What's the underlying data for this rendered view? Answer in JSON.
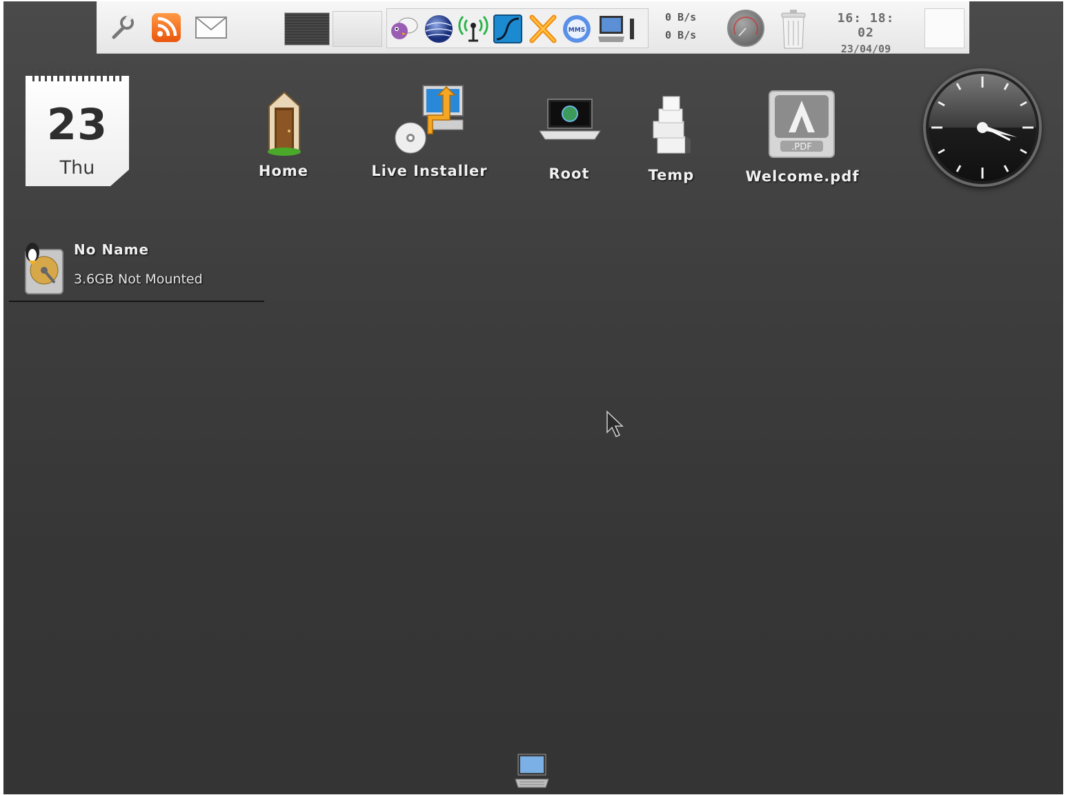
{
  "panel": {
    "launchers": [
      {
        "name": "settings",
        "icon": "wrench-icon"
      },
      {
        "name": "rss-reader",
        "icon": "rss-icon",
        "color": "#f07a1e"
      },
      {
        "name": "mail",
        "icon": "envelope-icon"
      }
    ],
    "tray_icons": [
      "chat-icon",
      "globe-icon",
      "wireless-icon",
      "monitor-graph-icon",
      "x-tools-icon",
      "mms-icon",
      "computer-icon"
    ],
    "net_speed": {
      "down": "0 B/s",
      "up": "0 B/s"
    },
    "clock": {
      "time": "16: 18: 02",
      "date": "23/04/09"
    }
  },
  "calendar": {
    "day_number": "23",
    "day_name": "Thu"
  },
  "desktop_icons": [
    {
      "label": "Home",
      "icon": "door-icon"
    },
    {
      "label": "Live Installer",
      "icon": "installer-icon"
    },
    {
      "label": "Root",
      "icon": "laptop-icon"
    },
    {
      "label": "Temp",
      "icon": "boxes-icon"
    },
    {
      "label": "Welcome.pdf",
      "icon": "pdf-icon"
    }
  ],
  "drive": {
    "name": "No Name",
    "status": "3.6GB Not Mounted",
    "icon": "hard-drive-icon"
  },
  "colors": {
    "desktop_bg": "#3e3e3e",
    "panel_bg": "#ececec",
    "rss": "#f07a1e"
  }
}
